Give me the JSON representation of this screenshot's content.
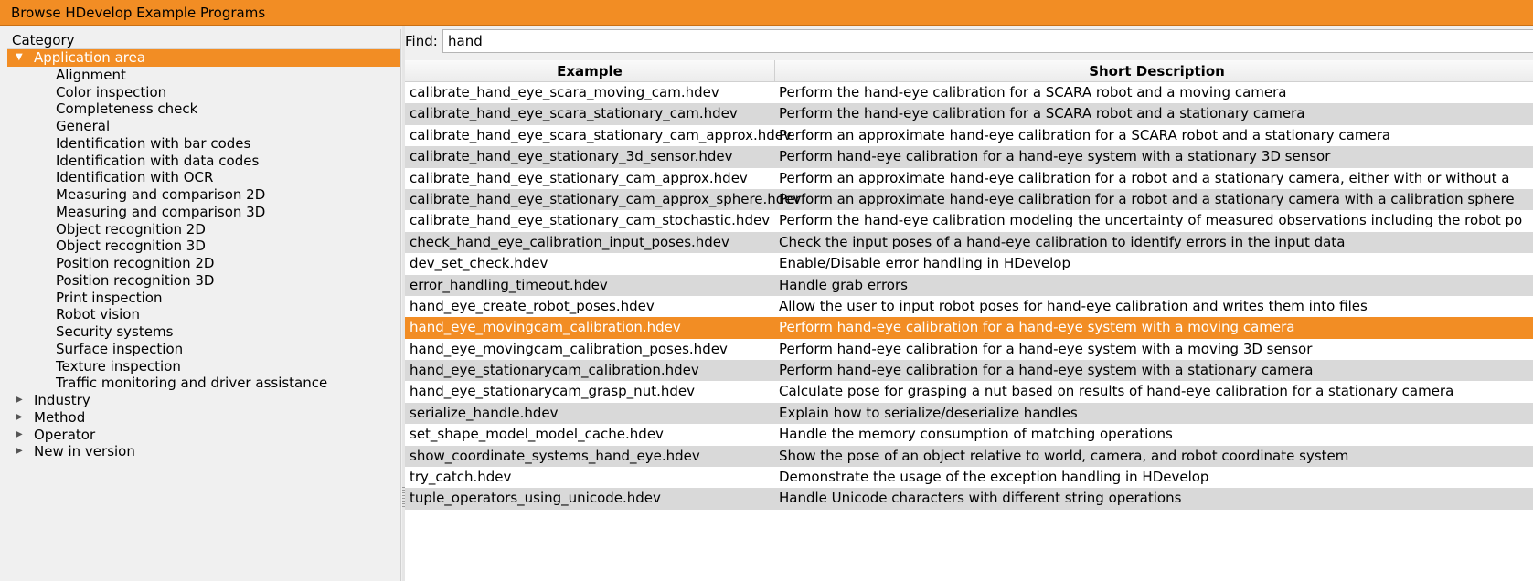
{
  "window": {
    "title": "Browse HDevelop Example Programs"
  },
  "category": {
    "header": "Category",
    "tree": [
      {
        "label": "Application area",
        "expanded": true,
        "selected": true,
        "level": 0,
        "children": [
          "Alignment",
          "Color inspection",
          "Completeness check",
          "General",
          "Identification with bar codes",
          "Identification with data codes",
          "Identification with OCR",
          "Measuring and comparison 2D",
          "Measuring and comparison 3D",
          "Object recognition 2D",
          "Object recognition 3D",
          "Position recognition 2D",
          "Position recognition 3D",
          "Print inspection",
          "Robot vision",
          "Security systems",
          "Surface inspection",
          "Texture inspection",
          "Traffic monitoring and driver assistance"
        ]
      },
      {
        "label": "Industry",
        "expanded": false,
        "level": 0
      },
      {
        "label": "Method",
        "expanded": false,
        "level": 0
      },
      {
        "label": "Operator",
        "expanded": false,
        "level": 0
      },
      {
        "label": "New in version",
        "expanded": false,
        "level": 0
      }
    ]
  },
  "find": {
    "label": "Find:",
    "value": "hand"
  },
  "table": {
    "columns": [
      "Example",
      "Short Description"
    ],
    "selected_index": 11,
    "rows": [
      [
        "calibrate_hand_eye_scara_moving_cam.hdev",
        "Perform the hand-eye calibration for a SCARA robot and a moving camera"
      ],
      [
        "calibrate_hand_eye_scara_stationary_cam.hdev",
        "Perform the hand-eye calibration for a SCARA robot and a stationary camera"
      ],
      [
        "calibrate_hand_eye_scara_stationary_cam_approx.hdev",
        "Perform an approximate hand-eye calibration for a SCARA robot and a stationary camera"
      ],
      [
        "calibrate_hand_eye_stationary_3d_sensor.hdev",
        "Perform hand-eye calibration for a hand-eye system with a stationary 3D sensor"
      ],
      [
        "calibrate_hand_eye_stationary_cam_approx.hdev",
        "Perform an approximate hand-eye calibration for a robot and a stationary camera, either with or without a"
      ],
      [
        "calibrate_hand_eye_stationary_cam_approx_sphere.hdev",
        "Perform an approximate hand-eye calibration for a robot and a stationary camera with a calibration sphere"
      ],
      [
        "calibrate_hand_eye_stationary_cam_stochastic.hdev",
        "Perform the hand-eye calibration modeling the uncertainty of measured observations including the robot po"
      ],
      [
        "check_hand_eye_calibration_input_poses.hdev",
        "Check the input poses of a hand-eye calibration to identify errors in the input data"
      ],
      [
        "dev_set_check.hdev",
        "Enable/Disable error handling in HDevelop"
      ],
      [
        "error_handling_timeout.hdev",
        "Handle grab errors"
      ],
      [
        "hand_eye_create_robot_poses.hdev",
        "Allow the user to input robot poses for hand-eye calibration and writes them into files"
      ],
      [
        "hand_eye_movingcam_calibration.hdev",
        "Perform hand-eye calibration for a hand-eye system with a moving camera"
      ],
      [
        "hand_eye_movingcam_calibration_poses.hdev",
        "Perform hand-eye calibration for a hand-eye system with a moving 3D sensor"
      ],
      [
        "hand_eye_stationarycam_calibration.hdev",
        "Perform hand-eye calibration for a hand-eye system with a stationary camera"
      ],
      [
        "hand_eye_stationarycam_grasp_nut.hdev",
        "Calculate pose for grasping a nut based on results of hand-eye calibration for a stationary camera"
      ],
      [
        "serialize_handle.hdev",
        "Explain how to serialize/deserialize handles"
      ],
      [
        "set_shape_model_model_cache.hdev",
        "Handle the memory consumption of matching operations"
      ],
      [
        "show_coordinate_systems_hand_eye.hdev",
        "Show the pose of an object relative to world, camera, and robot coordinate system"
      ],
      [
        "try_catch.hdev",
        "Demonstrate the usage of the exception handling in HDevelop"
      ],
      [
        "tuple_operators_using_unicode.hdev",
        "Handle Unicode characters with different string operations"
      ]
    ]
  },
  "colors": {
    "accent": "#f28d24",
    "row_alt": "#d9d9d9"
  }
}
